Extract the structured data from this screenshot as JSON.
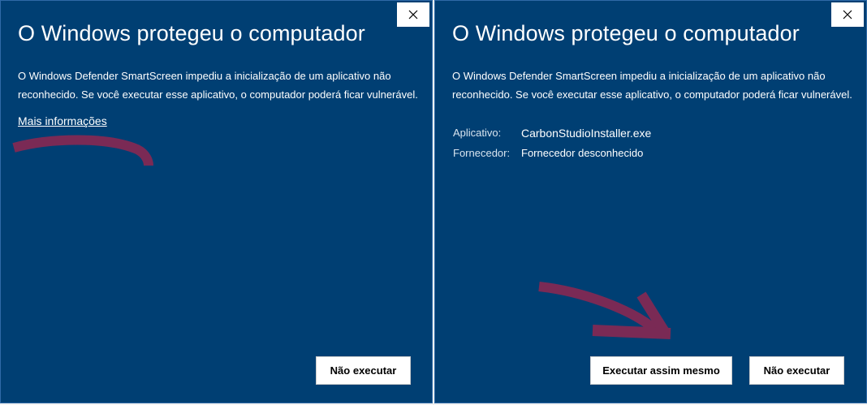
{
  "left_dialog": {
    "title": "O Windows protegeu o computador",
    "description": "O Windows Defender SmartScreen impediu a inicialização de um aplicativo não reconhecido. Se você executar esse aplicativo, o computador poderá ficar vulnerável.",
    "more_info_link": "Mais informações",
    "dont_run_button": "Não executar",
    "close_icon": "close-icon"
  },
  "right_dialog": {
    "title": "O Windows protegeu o computador",
    "description": "O Windows Defender SmartScreen impediu a inicialização de um aplicativo não reconhecido. Se você executar esse aplicativo, o computador poderá ficar vulnerável.",
    "app_label": "Aplicativo:",
    "app_value": "CarbonStudioInstaller.exe",
    "publisher_label": "Fornecedor:",
    "publisher_value": "Fornecedor desconhecido",
    "run_anyway_button": "Executar assim mesmo",
    "dont_run_button": "Não executar",
    "close_icon": "close-icon"
  },
  "colors": {
    "dialog_bg": "#003f73",
    "annotation": "#7a2a55"
  }
}
